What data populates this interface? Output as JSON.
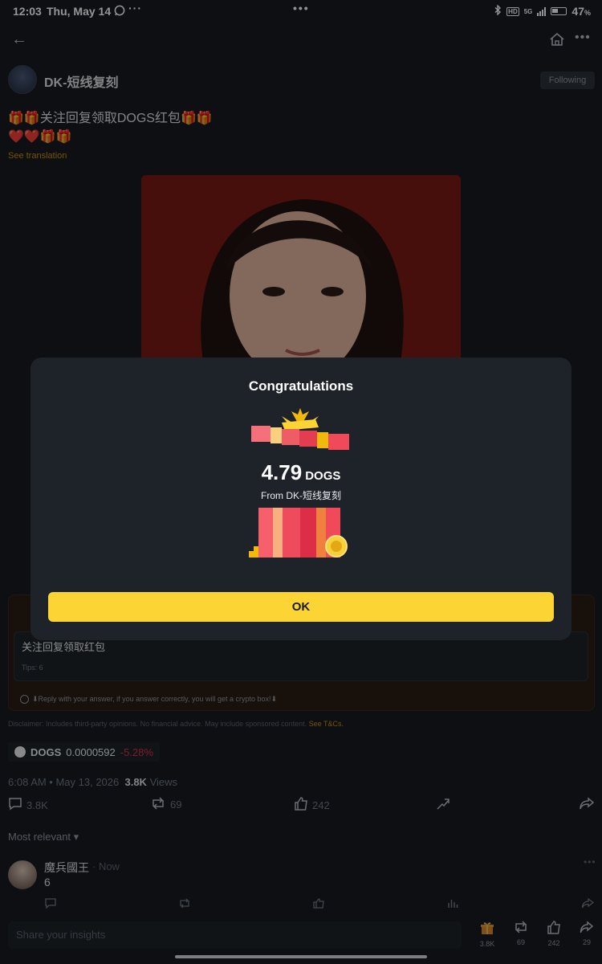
{
  "status_bar": {
    "time": "12:03",
    "date": "Thu, May 14",
    "battery": "47"
  },
  "post": {
    "author": "DK-短线复刻",
    "follow_label": "Following",
    "text_line1": "🎁🎁关注回复领取DOGS红包🎁🎁",
    "text_line2": "❤️❤️🎁🎁",
    "see_translation": "See translation",
    "task": {
      "question": "关注回复领取红包",
      "tips": "Tips: 6",
      "reply_hint": "⬇Reply with your answer, if you answer correctly, you will get a crypto box!⬇"
    },
    "disclaimer": "Disclaimer: Includes third-party opinions. No financial advice. May include sponsored content.",
    "disclaimer_link": "See T&Cs.",
    "coin": {
      "symbol": "DOGS",
      "price": "0.0000592",
      "change": "-5.28%"
    },
    "meta_time": "6:08 AM • May 13, 2026",
    "meta_views": "3.8K",
    "meta_views_label": "Views",
    "actions": {
      "comments": "3.8K",
      "reposts": "69",
      "likes": "242"
    }
  },
  "comments": {
    "sort_label": "Most relevant ▾",
    "items": [
      {
        "name": "魔兵國王",
        "time": "· Now",
        "text": "6"
      }
    ]
  },
  "bottom_bar": {
    "placeholder": "Share your insights",
    "gift_count": "3.8K",
    "repost_count": "69",
    "like_count": "242",
    "share_count": "29"
  },
  "modal": {
    "title": "Congratulations",
    "amount": "4.79",
    "token": "DOGS",
    "from": "From DK-短线复刻",
    "ok_label": "OK"
  }
}
